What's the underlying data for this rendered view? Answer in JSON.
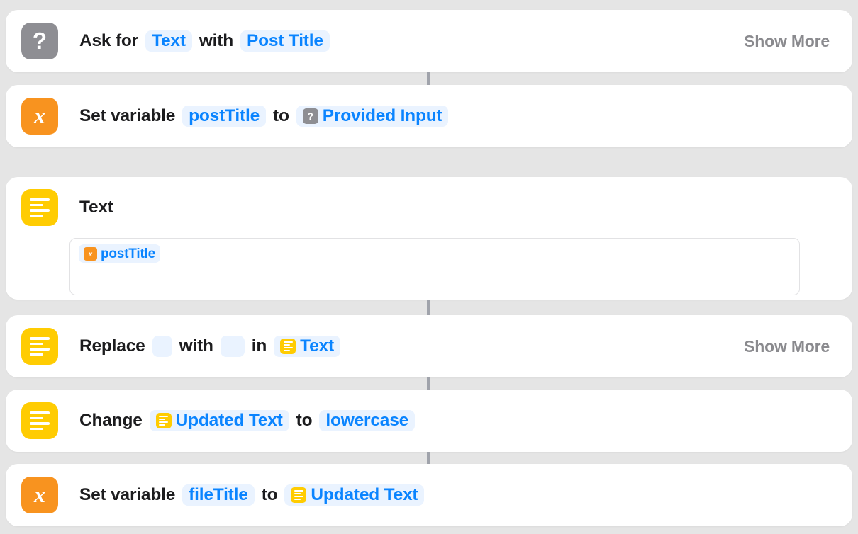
{
  "app": {
    "name": "Shortcuts Editor",
    "background_color": "#e5e5e5",
    "card_color": "#ffffff",
    "accent_blue": "#0a84ff",
    "pill_background": "#eaf3ff",
    "connector_color": "#a0a3ab",
    "show_more_label": "Show More"
  },
  "actions": [
    {
      "id": "ask-for-input",
      "icon": "question-mark-icon",
      "icon_color": "#8e8e93",
      "tokens": [
        {
          "type": "word",
          "text": "Ask for"
        },
        {
          "type": "pill",
          "text": "Text"
        },
        {
          "type": "word",
          "text": "with"
        },
        {
          "type": "pill",
          "text": "Post Title"
        }
      ],
      "show_more": "Show More"
    },
    {
      "id": "set-variable-posttitle",
      "icon": "variable-x-icon",
      "icon_color": "#f8931f",
      "tokens": [
        {
          "type": "word",
          "text": "Set variable"
        },
        {
          "type": "pill",
          "text": "postTitle"
        },
        {
          "type": "word",
          "text": "to"
        },
        {
          "type": "pill",
          "text": "Provided Input",
          "mini_icon": "question-mark-icon",
          "mini_color": "#8e8e93"
        }
      ]
    },
    {
      "id": "text-action",
      "icon": "text-lines-icon",
      "icon_color": "#ffcc02",
      "title": "Text",
      "field_value": "postTitle",
      "field_mini_icon": "variable-x-icon",
      "field_mini_color": "#f8931f"
    },
    {
      "id": "replace-text",
      "icon": "text-lines-icon",
      "icon_color": "#ffcc02",
      "tokens": [
        {
          "type": "word",
          "text": "Replace"
        },
        {
          "type": "pill",
          "text": " "
        },
        {
          "type": "word",
          "text": "with"
        },
        {
          "type": "pill",
          "text": "_"
        },
        {
          "type": "word",
          "text": "in"
        },
        {
          "type": "pill",
          "text": "Text",
          "mini_icon": "text-lines-icon",
          "mini_color": "#ffcc02"
        }
      ],
      "show_more": "Show More"
    },
    {
      "id": "change-case",
      "icon": "text-lines-icon",
      "icon_color": "#ffcc02",
      "tokens": [
        {
          "type": "word",
          "text": "Change"
        },
        {
          "type": "pill",
          "text": "Updated Text",
          "mini_icon": "text-lines-icon",
          "mini_color": "#ffcc02"
        },
        {
          "type": "word",
          "text": "to"
        },
        {
          "type": "pill",
          "text": "lowercase"
        }
      ]
    },
    {
      "id": "set-variable-filetitle",
      "icon": "variable-x-icon",
      "icon_color": "#f8931f",
      "tokens": [
        {
          "type": "word",
          "text": "Set variable"
        },
        {
          "type": "pill",
          "text": "fileTitle"
        },
        {
          "type": "word",
          "text": "to"
        },
        {
          "type": "pill",
          "text": "Updated Text",
          "mini_icon": "text-lines-icon",
          "mini_color": "#ffcc02"
        }
      ]
    }
  ]
}
